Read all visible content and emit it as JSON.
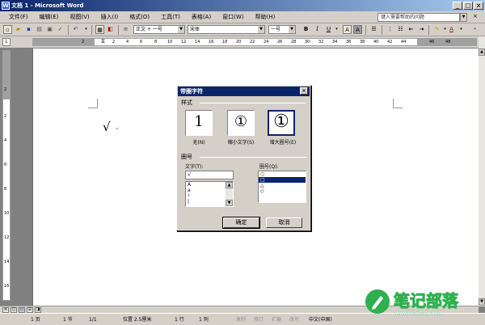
{
  "window": {
    "title": "文档 1 - Microsoft Word",
    "app_icon": "W",
    "minimize": "_",
    "maximize": "□",
    "close": "×"
  },
  "menu": {
    "items": [
      "文件(F)",
      "编辑(E)",
      "视图(V)",
      "插入(I)",
      "格式(O)",
      "工具(T)",
      "表格(A)",
      "窗口(W)",
      "帮助(H)"
    ],
    "help_box_placeholder": "键入需要帮助的问题",
    "doc_close": "×"
  },
  "toolbar": {
    "style_value": "正文 + 一号",
    "font_value": "宋体",
    "size_value": "一号",
    "bold": "B",
    "italic": "I",
    "underline": "U",
    "char_border": "A",
    "char_shade": "A",
    "font_color": "A",
    "icons": [
      "new-icon",
      "open-icon",
      "save-icon",
      "print-icon",
      "print-preview-icon",
      "spelling-icon",
      "undo-icon",
      "redo-icon",
      "insert-table-icon",
      "align-icon",
      "numbering-icon",
      "bullets-icon",
      "highlight-icon",
      "font-color-icon"
    ]
  },
  "ruler": {
    "corner": "L",
    "h_numbers": [
      "2",
      "2",
      "4",
      "6",
      "8",
      "10",
      "12",
      "14",
      "16",
      "18",
      "20",
      "22",
      "24",
      "26",
      "28",
      "30",
      "32",
      "34",
      "36",
      "38",
      "40",
      "42",
      "44",
      "46",
      "48"
    ],
    "v_numbers": [
      "2",
      "2",
      "4",
      "6",
      "8",
      "10",
      "12",
      "14",
      "16"
    ]
  },
  "document": {
    "content": "√",
    "paragraph_mark": "↵"
  },
  "dialog": {
    "title": "带圈字符",
    "close": "×",
    "style_group": "样式",
    "styles": [
      {
        "glyph": "1",
        "caption": "无(N)"
      },
      {
        "glyph": "①",
        "caption": "缩小文字(S)"
      },
      {
        "glyph": "①",
        "caption": "增大圈号(E)"
      }
    ],
    "circle_group": "圈号",
    "text_label": "文字(T):",
    "text_value": "√",
    "text_list": [
      "A",
      "a",
      "!",
      "|"
    ],
    "enclosure_label": "圈号(Q):",
    "enclosure_list": [
      "○",
      "□",
      "△",
      "◇"
    ],
    "ok": "确定",
    "cancel": "取消"
  },
  "statusbar": {
    "page": "1 页",
    "section": "1 节",
    "page_of": "1/1",
    "position": "位置 2.5厘米",
    "line": "1 行",
    "column": "1 列",
    "rec": "录制",
    "trk": "修订",
    "ext": "扩展",
    "ovr": "改写",
    "language": "中文(中国)"
  },
  "watermark": {
    "text": "笔记部落",
    "url": "www.notetribe.com"
  }
}
